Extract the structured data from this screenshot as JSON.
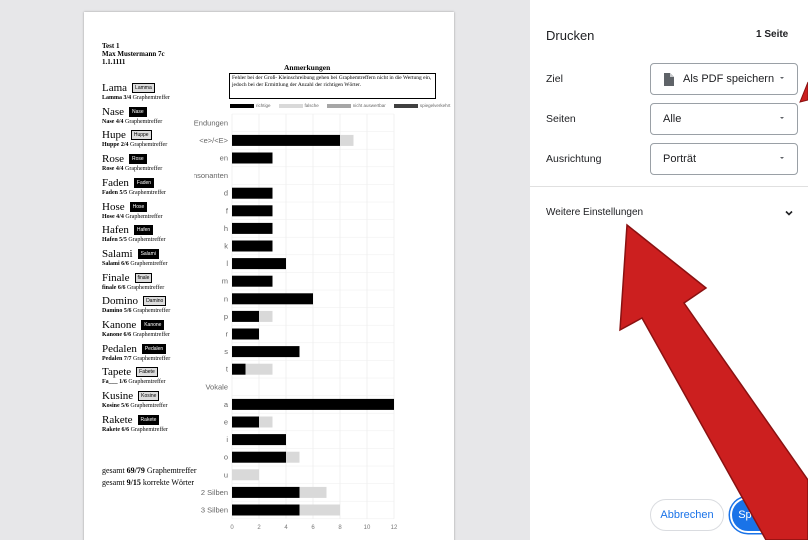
{
  "document": {
    "header": {
      "title": "Test 1",
      "name_class": "Max Mustermann  7c",
      "date": "1.1.1111"
    },
    "words": [
      {
        "word": "Lama",
        "tag": "Lamma",
        "tag_style": "light",
        "attempt": "Lamma",
        "score": "3/4",
        "suffix": "Graphemtreffer"
      },
      {
        "word": "Nase",
        "tag": "Nase",
        "tag_style": "dark",
        "attempt": "Nase",
        "score": "4/4",
        "suffix": "Graphemtreffer"
      },
      {
        "word": "Hupe",
        "tag": "Huppe",
        "tag_style": "light",
        "attempt": "Huppe",
        "score": "2/4",
        "suffix": "Graphemtreffer"
      },
      {
        "word": "Rose",
        "tag": "Rose",
        "tag_style": "dark",
        "attempt": "Rose",
        "score": "4/4",
        "suffix": "Graphemtreffer"
      },
      {
        "word": "Faden",
        "tag": "Faden",
        "tag_style": "dark",
        "attempt": "Faden",
        "score": "5/5",
        "suffix": "Graphemtreffer"
      },
      {
        "word": "Hose",
        "tag": "Hose",
        "tag_style": "dark",
        "attempt": "Hose",
        "score": "4/4",
        "suffix": "Graphemtreffer"
      },
      {
        "word": "Hafen",
        "tag": "Hafen",
        "tag_style": "dark",
        "attempt": "Hafen",
        "score": "5/5",
        "suffix": "Graphemtreffer"
      },
      {
        "word": "Salami",
        "tag": "Salami",
        "tag_style": "dark",
        "attempt": "Salami",
        "score": "6/6",
        "suffix": "Graphemtreffer"
      },
      {
        "word": "Finale",
        "tag": "finale",
        "tag_style": "light",
        "attempt": "finale",
        "score": "6/6",
        "suffix": "Graphemtreffer"
      },
      {
        "word": "Domino",
        "tag": "Damino",
        "tag_style": "light",
        "attempt": "Damino",
        "score": "5/6",
        "suffix": "Graphemtreffer"
      },
      {
        "word": "Kanone",
        "tag": "Kanone",
        "tag_style": "dark",
        "attempt": "Kanone",
        "score": "6/6",
        "suffix": "Graphemtreffer"
      },
      {
        "word": "Pedalen",
        "tag": "Pedalen",
        "tag_style": "dark",
        "attempt": "Pedalen",
        "score": "7/7",
        "suffix": "Graphemtreffer"
      },
      {
        "word": "Tapete",
        "tag": "Fabete",
        "tag_style": "light",
        "attempt": "Fa___",
        "score": "1/6",
        "suffix": "Graphemtreffer"
      },
      {
        "word": "Kusine",
        "tag": "Kosine",
        "tag_style": "light",
        "attempt": "Kosine",
        "score": "5/6",
        "suffix": "Graphemtreffer"
      },
      {
        "word": "Rakete",
        "tag": "Rakete",
        "tag_style": "dark",
        "attempt": "Rakete",
        "score": "6/6",
        "suffix": "Graphemtreffer"
      }
    ],
    "totals": {
      "line1_prefix": "gesamt ",
      "line1_value": "69/79",
      "line1_suffix": " Graphemtreffer",
      "line2_prefix": "gesamt ",
      "line2_value": "9/15",
      "line2_suffix": " korrekte Wörter"
    },
    "remarks": {
      "title": "Anmerkungen",
      "text": "Fehler bei der Groß- Kleinschreibung gehen bei Graphemtreffern nicht in die Wertung ein, jedoch bei der Ermittlung der Anzahl der richtigen Wörter."
    },
    "legend": [
      {
        "label": "richtige",
        "color": "#000000"
      },
      {
        "label": "falsche",
        "color": "#d9d9d9"
      },
      {
        "label": "nicht auswertbar",
        "color": "#a6a6a6"
      },
      {
        "label": "spiegelverkehrt",
        "color": "#404040"
      }
    ]
  },
  "chart_data": {
    "type": "bar",
    "orientation": "horizontal",
    "stacked": true,
    "categories": [
      "Endungen",
      "<e>/<E>",
      "en",
      "Konsonanten",
      "d",
      "f",
      "h",
      "k",
      "l",
      "m",
      "n",
      "p",
      "r",
      "s",
      "t",
      "Vokale",
      "a",
      "e",
      "i",
      "o",
      "u",
      "2 Silben",
      "3 Silben"
    ],
    "group_headers": [
      "Endungen",
      "Konsonanten",
      "Vokale"
    ],
    "series": [
      {
        "name": "richtige",
        "color": "#000000",
        "values": [
          0,
          8,
          3,
          0,
          3,
          3,
          3,
          3,
          4,
          3,
          6,
          2,
          2,
          5,
          1,
          0,
          12,
          2,
          4,
          4,
          0,
          5,
          5
        ]
      },
      {
        "name": "falsche",
        "color": "#d9d9d9",
        "values": [
          0,
          1,
          0,
          0,
          0,
          0,
          0,
          0,
          0,
          0,
          0,
          1,
          0,
          0,
          2,
          0,
          0,
          1,
          0,
          1,
          2,
          2,
          3
        ]
      }
    ],
    "xlim": [
      0,
      12
    ],
    "xticks": [
      0,
      2,
      4,
      6,
      8,
      10,
      12
    ],
    "grid": true
  },
  "print_dialog": {
    "title": "Drucken",
    "page_count": "1 Seite",
    "destination_label": "Ziel",
    "destination_value": "Als PDF speichern",
    "pages_label": "Seiten",
    "pages_value": "Alle",
    "orientation_label": "Ausrichtung",
    "orientation_value": "Porträt",
    "more_settings": "Weitere Einstellungen",
    "cancel": "Abbrechen",
    "save": "Speichern"
  },
  "colors": {
    "preview_bg": "#e7e7e9",
    "accent": "#1a73e8",
    "arrow": "#cc1f1f"
  }
}
